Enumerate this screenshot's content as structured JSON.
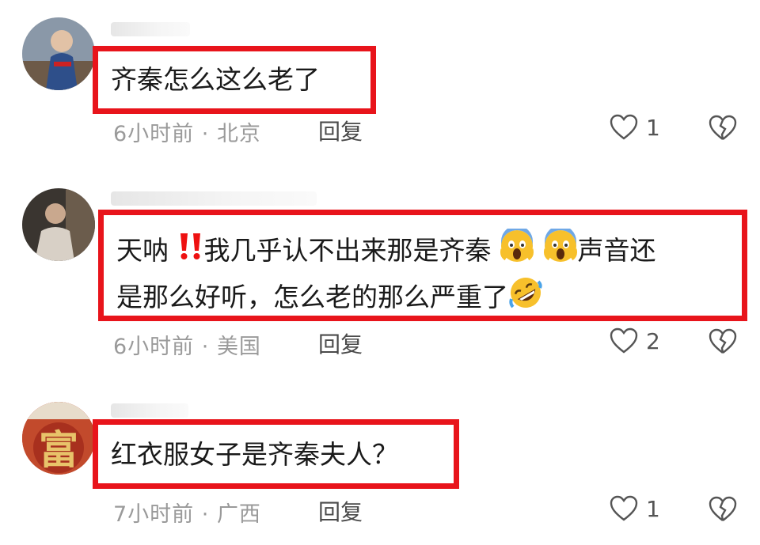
{
  "comments": [
    {
      "text_lines": [
        "齐秦怎么这么老了"
      ],
      "time": "6小时前",
      "location": "北京",
      "reply_label": "回复",
      "likes": "1",
      "avatar_icon": "user-avatar-photo"
    },
    {
      "text_line1_a": "天呐",
      "text_line1_b": "我几乎认不出来那是齐秦",
      "text_line1_c": "声音还",
      "text_line2": "是那么好听，怎么老的那么严重了",
      "time": "6小时前",
      "location": "美国",
      "reply_label": "回复",
      "likes": "2",
      "emojis": [
        "double-exclamation-icon",
        "screaming-face-icon",
        "screaming-face-icon",
        "rolling-laughing-face-icon"
      ]
    },
    {
      "text_lines": [
        "红衣服女子是齐秦夫人？"
      ],
      "time": "7小时前",
      "location": "广西",
      "reply_label": "回复",
      "likes": "1",
      "avatar_icon": "fu-character-avatar",
      "avatar_text": "富"
    }
  ],
  "meta_separator": " · ",
  "colors": {
    "highlight_border": "#e8141b",
    "meta_text": "#9a9a9a"
  }
}
